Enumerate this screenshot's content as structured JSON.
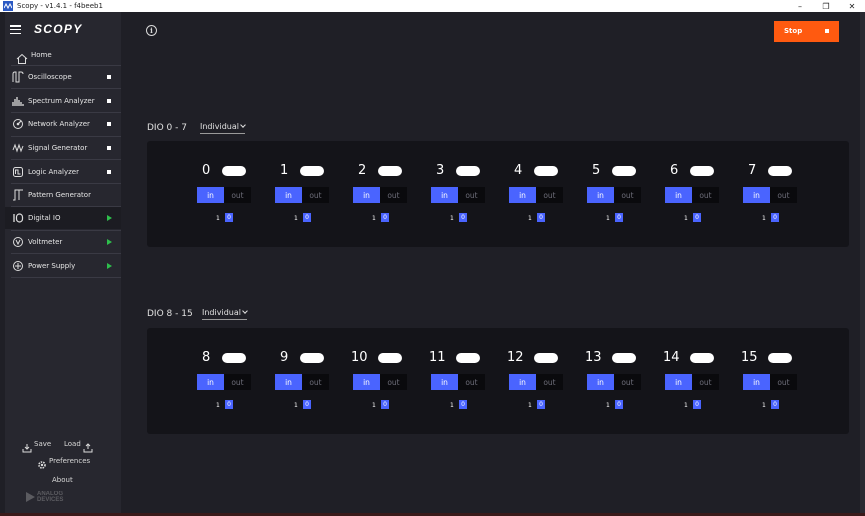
{
  "window": {
    "title": "Scopy - v1.4.1 - f4beeb1",
    "minimize_glyph": "–",
    "restore_glyph": "❐",
    "close_glyph": "✕"
  },
  "sidebar": {
    "logo": "SCOPY",
    "home_label": "Home",
    "items": [
      {
        "label": "Oscilloscope",
        "icon": "oscilloscope-icon",
        "status": "square"
      },
      {
        "label": "Spectrum Analyzer",
        "icon": "spectrum-icon",
        "status": "square"
      },
      {
        "label": "Network Analyzer",
        "icon": "network-icon",
        "status": "square"
      },
      {
        "label": "Signal Generator",
        "icon": "signal-icon",
        "status": "square"
      },
      {
        "label": "Logic Analyzer",
        "icon": "logic-icon",
        "status": "square"
      },
      {
        "label": "Pattern Generator",
        "icon": "pattern-icon",
        "status": "none"
      },
      {
        "label": "Digital IO",
        "icon": "digital-io-icon",
        "status": "play",
        "active": true
      },
      {
        "label": "Voltmeter",
        "icon": "voltmeter-icon",
        "status": "play"
      },
      {
        "label": "Power Supply",
        "icon": "power-icon",
        "status": "play"
      }
    ],
    "save_label": "Save",
    "load_label": "Load",
    "preferences_label": "Preferences",
    "about_label": "About",
    "vendor_line1": "ANALOG",
    "vendor_line2": "DEVICES"
  },
  "toolbar": {
    "info_glyph": "i",
    "stop_label": "Stop"
  },
  "groups": [
    {
      "title": "DIO 0 - 7",
      "mode": "Individual",
      "channels": [
        {
          "num": "0",
          "in": "in",
          "out": "out",
          "v1": "1",
          "v0": "0"
        },
        {
          "num": "1",
          "in": "in",
          "out": "out",
          "v1": "1",
          "v0": "0"
        },
        {
          "num": "2",
          "in": "in",
          "out": "out",
          "v1": "1",
          "v0": "0"
        },
        {
          "num": "3",
          "in": "in",
          "out": "out",
          "v1": "1",
          "v0": "0"
        },
        {
          "num": "4",
          "in": "in",
          "out": "out",
          "v1": "1",
          "v0": "0"
        },
        {
          "num": "5",
          "in": "in",
          "out": "out",
          "v1": "1",
          "v0": "0"
        },
        {
          "num": "6",
          "in": "in",
          "out": "out",
          "v1": "1",
          "v0": "0"
        },
        {
          "num": "7",
          "in": "in",
          "out": "out",
          "v1": "1",
          "v0": "0"
        }
      ]
    },
    {
      "title": "DIO 8 - 15",
      "mode": "Individual",
      "channels": [
        {
          "num": "8",
          "in": "in",
          "out": "out",
          "v1": "1",
          "v0": "0"
        },
        {
          "num": "9",
          "in": "in",
          "out": "out",
          "v1": "1",
          "v0": "0"
        },
        {
          "num": "10",
          "in": "in",
          "out": "out",
          "v1": "1",
          "v0": "0"
        },
        {
          "num": "11",
          "in": "in",
          "out": "out",
          "v1": "1",
          "v0": "0"
        },
        {
          "num": "12",
          "in": "in",
          "out": "out",
          "v1": "1",
          "v0": "0"
        },
        {
          "num": "13",
          "in": "in",
          "out": "out",
          "v1": "1",
          "v0": "0"
        },
        {
          "num": "14",
          "in": "in",
          "out": "out",
          "v1": "1",
          "v0": "0"
        },
        {
          "num": "15",
          "in": "in",
          "out": "out",
          "v1": "1",
          "v0": "0"
        }
      ]
    }
  ],
  "colors": {
    "accent_blue": "#4a64ff",
    "stop_orange": "#ff5a10",
    "running_green": "#2ebf4c"
  }
}
